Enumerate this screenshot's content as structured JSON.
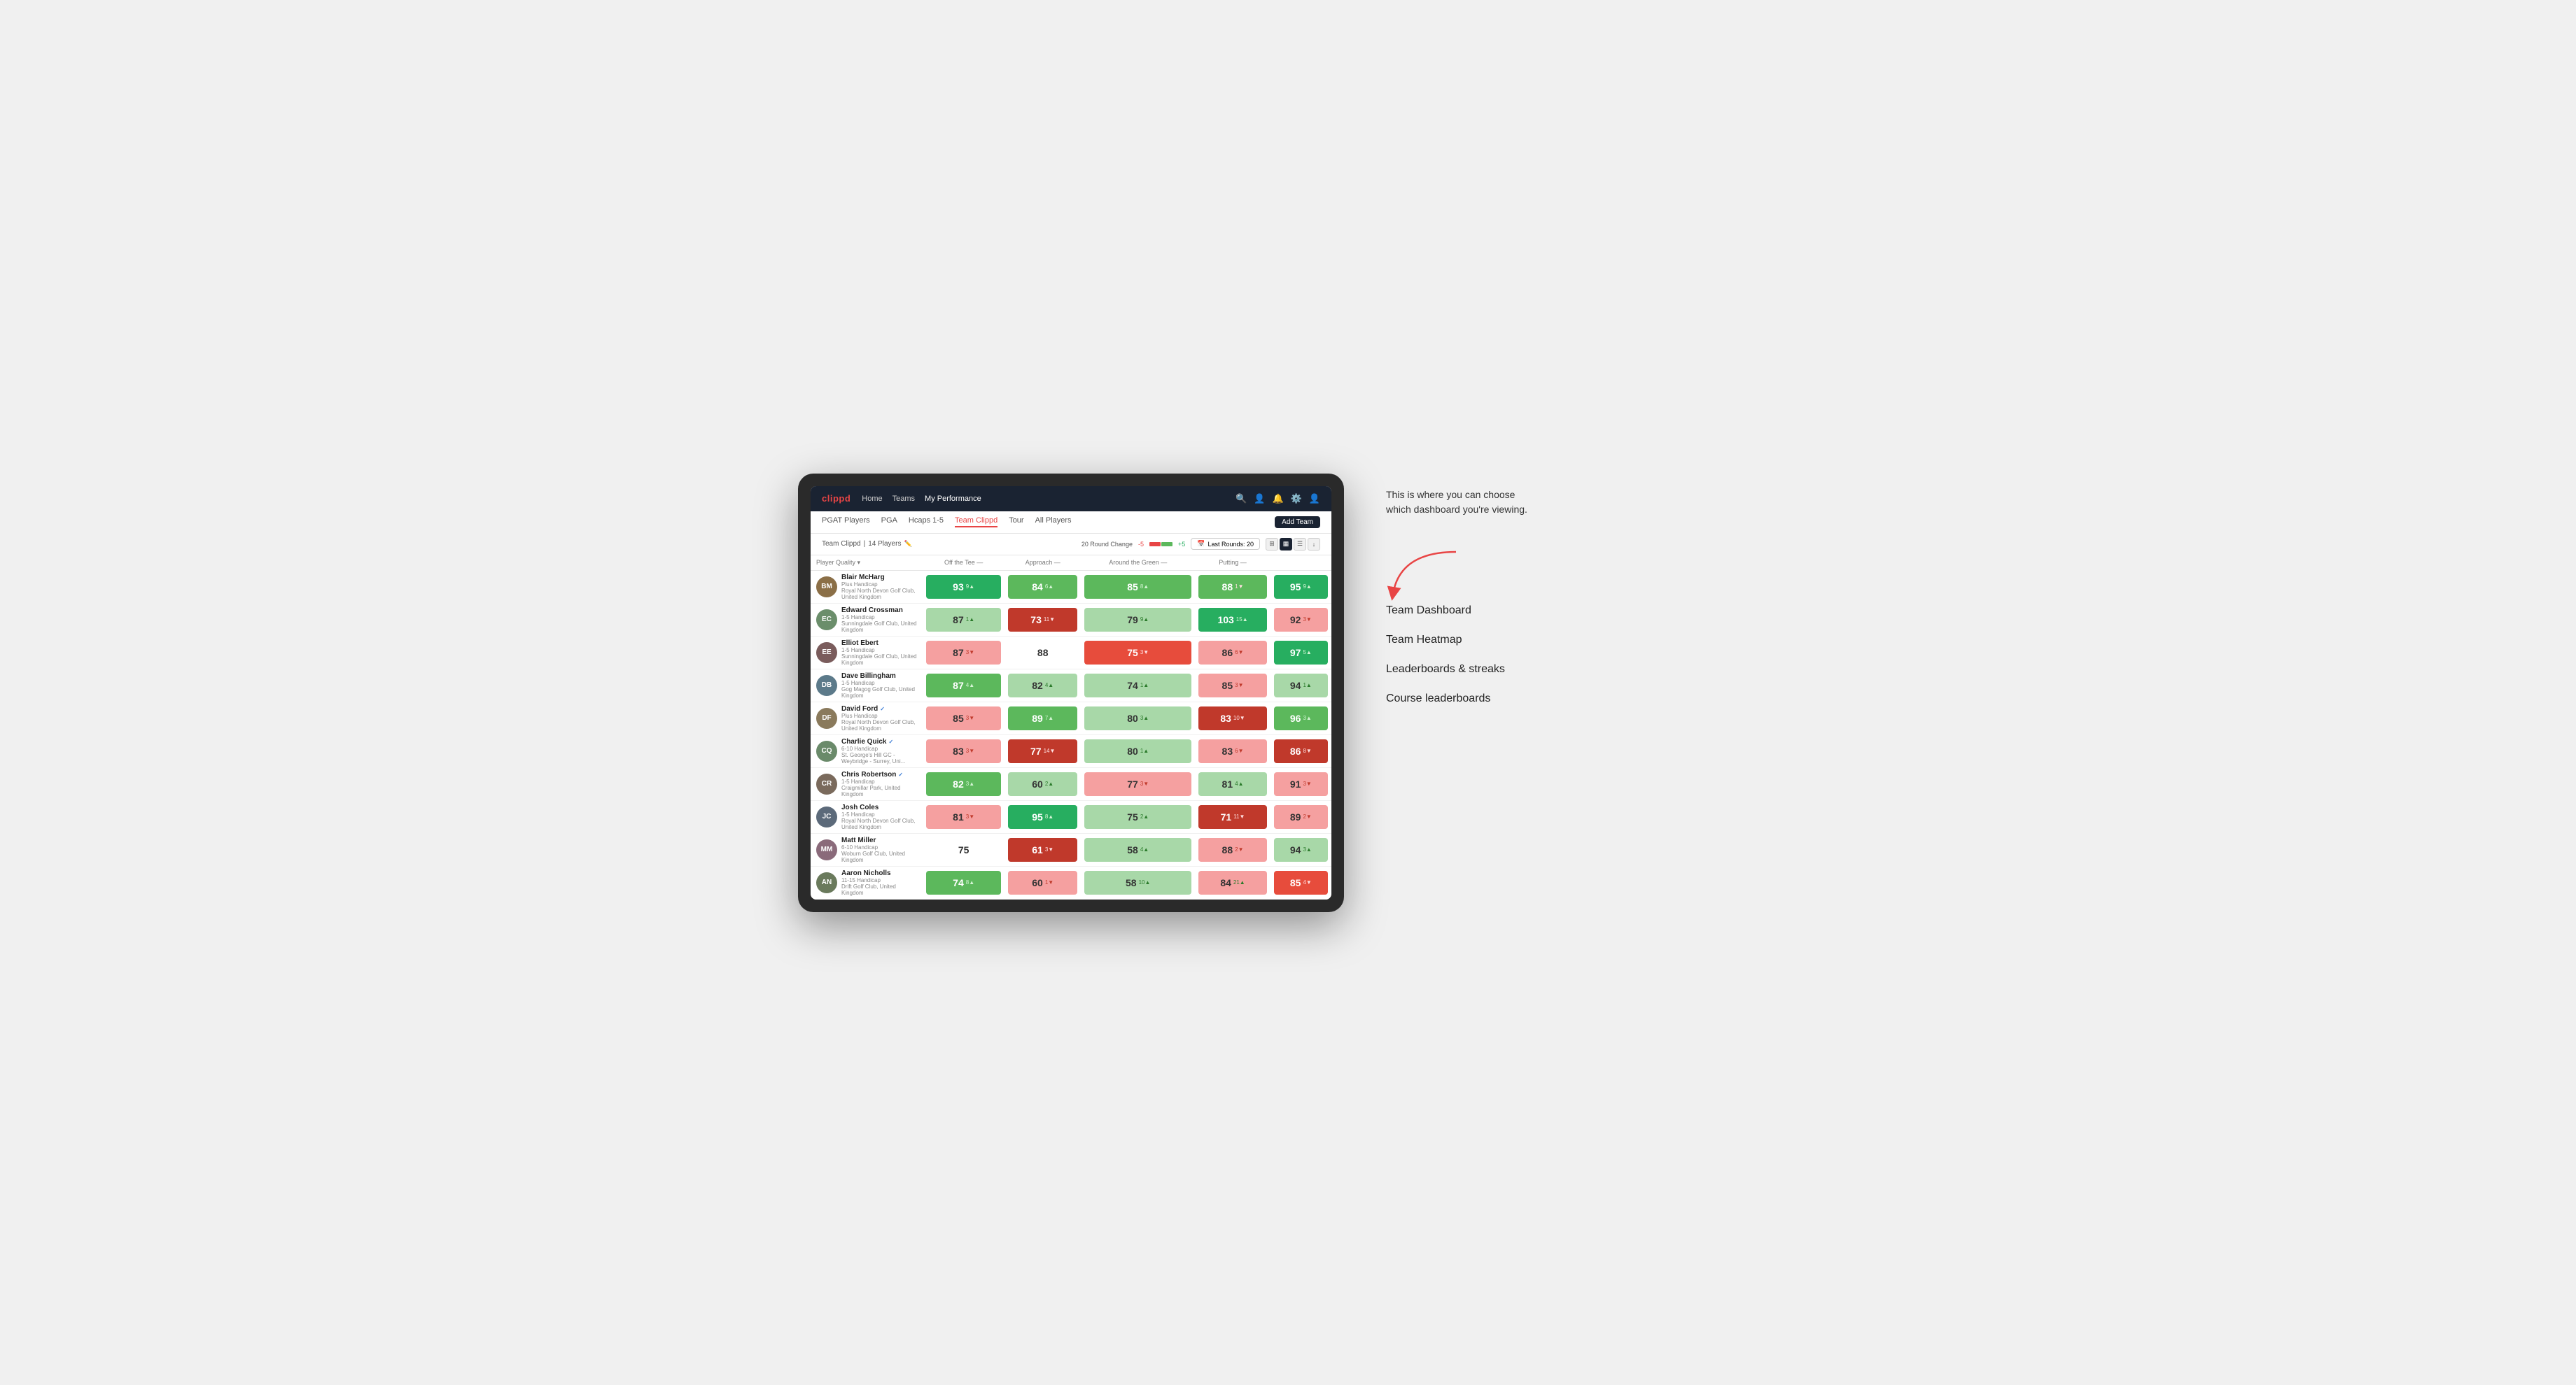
{
  "annotation": {
    "description": "This is where you can choose which dashboard you're viewing.",
    "options": [
      "Team Dashboard",
      "Team Heatmap",
      "Leaderboards & streaks",
      "Course leaderboards"
    ]
  },
  "nav": {
    "logo": "clippd",
    "links": [
      "Home",
      "Teams",
      "My Performance"
    ],
    "active_link": "My Performance"
  },
  "sub_nav": {
    "links": [
      "PGAT Players",
      "PGA",
      "Hcaps 1-5",
      "Team Clippd",
      "Tour",
      "All Players"
    ],
    "active": "Team Clippd",
    "add_team_label": "Add Team"
  },
  "team_header": {
    "team_name": "Team Clippd",
    "player_count": "14 Players",
    "round_change_label": "20 Round Change",
    "change_min": "-5",
    "change_max": "+5",
    "last_rounds_label": "Last Rounds: 20"
  },
  "table": {
    "col_headers": {
      "player": "Player Quality ▾",
      "off_tee": "Off the Tee —",
      "approach": "Approach —",
      "around_green": "Around the Green —",
      "putting": "Putting —"
    },
    "players": [
      {
        "name": "Blair McHarg",
        "handicap": "Plus Handicap",
        "club": "Royal North Devon Golf Club, United Kingdom",
        "initials": "BM",
        "avatar_color": "#8B6F47",
        "off_tee": {
          "val": "93",
          "change": "9▲",
          "dir": "up",
          "bg": "bg-green-strong"
        },
        "approach": {
          "val": "84",
          "change": "6▲",
          "dir": "up",
          "bg": "bg-green-mid"
        },
        "around_green": {
          "val": "85",
          "change": "8▲",
          "dir": "up",
          "bg": "bg-green-mid"
        },
        "atg": {
          "val": "88",
          "change": "1▼",
          "dir": "down",
          "bg": "bg-green-mid"
        },
        "putting": {
          "val": "95",
          "change": "9▲",
          "dir": "up",
          "bg": "bg-green-strong"
        }
      },
      {
        "name": "Edward Crossman",
        "handicap": "1-5 Handicap",
        "club": "Sunningdale Golf Club, United Kingdom",
        "initials": "EC",
        "avatar_color": "#6B8E6B",
        "off_tee": {
          "val": "87",
          "change": "1▲",
          "dir": "up",
          "bg": "bg-green-light"
        },
        "approach": {
          "val": "73",
          "change": "11▼",
          "dir": "down",
          "bg": "bg-red-strong"
        },
        "around_green": {
          "val": "79",
          "change": "9▲",
          "dir": "up",
          "bg": "bg-green-light"
        },
        "atg": {
          "val": "103",
          "change": "15▲",
          "dir": "up",
          "bg": "bg-green-strong"
        },
        "putting": {
          "val": "92",
          "change": "3▼",
          "dir": "down",
          "bg": "bg-red-light"
        }
      },
      {
        "name": "Elliot Ebert",
        "handicap": "1-5 Handicap",
        "club": "Sunningdale Golf Club, United Kingdom",
        "initials": "EE",
        "avatar_color": "#7a5c5c",
        "off_tee": {
          "val": "87",
          "change": "3▼",
          "dir": "down",
          "bg": "bg-red-light"
        },
        "approach": {
          "val": "88",
          "change": "",
          "dir": "none",
          "bg": "bg-none"
        },
        "around_green": {
          "val": "75",
          "change": "3▼",
          "dir": "down",
          "bg": "bg-red-mid"
        },
        "atg": {
          "val": "86",
          "change": "6▼",
          "dir": "down",
          "bg": "bg-red-light"
        },
        "putting": {
          "val": "97",
          "change": "5▲",
          "dir": "up",
          "bg": "bg-green-strong"
        }
      },
      {
        "name": "Dave Billingham",
        "handicap": "1-5 Handicap",
        "club": "Gog Magog Golf Club, United Kingdom",
        "initials": "DB",
        "avatar_color": "#5c7a8a",
        "off_tee": {
          "val": "87",
          "change": "4▲",
          "dir": "up",
          "bg": "bg-green-mid"
        },
        "approach": {
          "val": "82",
          "change": "4▲",
          "dir": "up",
          "bg": "bg-green-light"
        },
        "around_green": {
          "val": "74",
          "change": "1▲",
          "dir": "up",
          "bg": "bg-green-light"
        },
        "atg": {
          "val": "85",
          "change": "3▼",
          "dir": "down",
          "bg": "bg-red-light"
        },
        "putting": {
          "val": "94",
          "change": "1▲",
          "dir": "up",
          "bg": "bg-green-light"
        }
      },
      {
        "name": "David Ford",
        "handicap": "Plus Handicap",
        "club": "Royal North Devon Golf Club, United Kingdom",
        "initials": "DF",
        "avatar_color": "#8a7a5c",
        "verified": true,
        "off_tee": {
          "val": "85",
          "change": "3▼",
          "dir": "down",
          "bg": "bg-red-light"
        },
        "approach": {
          "val": "89",
          "change": "7▲",
          "dir": "up",
          "bg": "bg-green-mid"
        },
        "around_green": {
          "val": "80",
          "change": "3▲",
          "dir": "up",
          "bg": "bg-green-light"
        },
        "atg": {
          "val": "83",
          "change": "10▼",
          "dir": "down",
          "bg": "bg-red-strong"
        },
        "putting": {
          "val": "96",
          "change": "3▲",
          "dir": "up",
          "bg": "bg-green-mid"
        }
      },
      {
        "name": "Charlie Quick",
        "handicap": "6-10 Handicap",
        "club": "St. George's Hill GC - Weybridge - Surrey, Uni...",
        "initials": "CQ",
        "avatar_color": "#6a8a6a",
        "verified": true,
        "off_tee": {
          "val": "83",
          "change": "3▼",
          "dir": "down",
          "bg": "bg-red-light"
        },
        "approach": {
          "val": "77",
          "change": "14▼",
          "dir": "down",
          "bg": "bg-red-strong"
        },
        "around_green": {
          "val": "80",
          "change": "1▲",
          "dir": "up",
          "bg": "bg-green-light"
        },
        "atg": {
          "val": "83",
          "change": "6▼",
          "dir": "down",
          "bg": "bg-red-light"
        },
        "putting": {
          "val": "86",
          "change": "8▼",
          "dir": "down",
          "bg": "bg-red-strong"
        }
      },
      {
        "name": "Chris Robertson",
        "handicap": "1-5 Handicap",
        "club": "Craigmillar Park, United Kingdom",
        "initials": "CR",
        "avatar_color": "#7a6a5c",
        "verified": true,
        "off_tee": {
          "val": "82",
          "change": "3▲",
          "dir": "up",
          "bg": "bg-green-mid"
        },
        "approach": {
          "val": "60",
          "change": "2▲",
          "dir": "up",
          "bg": "bg-green-light"
        },
        "around_green": {
          "val": "77",
          "change": "3▼",
          "dir": "down",
          "bg": "bg-red-light"
        },
        "atg": {
          "val": "81",
          "change": "4▲",
          "dir": "up",
          "bg": "bg-green-light"
        },
        "putting": {
          "val": "91",
          "change": "3▼",
          "dir": "down",
          "bg": "bg-red-light"
        }
      },
      {
        "name": "Josh Coles",
        "handicap": "1-5 Handicap",
        "club": "Royal North Devon Golf Club, United Kingdom",
        "initials": "JC",
        "avatar_color": "#5c6a7a",
        "off_tee": {
          "val": "81",
          "change": "3▼",
          "dir": "down",
          "bg": "bg-red-light"
        },
        "approach": {
          "val": "95",
          "change": "8▲",
          "dir": "up",
          "bg": "bg-green-strong"
        },
        "around_green": {
          "val": "75",
          "change": "2▲",
          "dir": "up",
          "bg": "bg-green-light"
        },
        "atg": {
          "val": "71",
          "change": "11▼",
          "dir": "down",
          "bg": "bg-red-strong"
        },
        "putting": {
          "val": "89",
          "change": "2▼",
          "dir": "down",
          "bg": "bg-red-light"
        }
      },
      {
        "name": "Matt Miller",
        "handicap": "6-10 Handicap",
        "club": "Woburn Golf Club, United Kingdom",
        "initials": "MM",
        "avatar_color": "#8a6a7a",
        "off_tee": {
          "val": "75",
          "change": "",
          "dir": "none",
          "bg": "bg-none"
        },
        "approach": {
          "val": "61",
          "change": "3▼",
          "dir": "down",
          "bg": "bg-red-strong"
        },
        "around_green": {
          "val": "58",
          "change": "4▲",
          "dir": "up",
          "bg": "bg-green-light"
        },
        "atg": {
          "val": "88",
          "change": "2▼",
          "dir": "down",
          "bg": "bg-red-light"
        },
        "putting": {
          "val": "94",
          "change": "3▲",
          "dir": "up",
          "bg": "bg-green-light"
        }
      },
      {
        "name": "Aaron Nicholls",
        "handicap": "11-15 Handicap",
        "club": "Drift Golf Club, United Kingdom",
        "initials": "AN",
        "avatar_color": "#6a7a5c",
        "off_tee": {
          "val": "74",
          "change": "8▲",
          "dir": "up",
          "bg": "bg-green-mid"
        },
        "approach": {
          "val": "60",
          "change": "1▼",
          "dir": "down",
          "bg": "bg-red-light"
        },
        "around_green": {
          "val": "58",
          "change": "10▲",
          "dir": "up",
          "bg": "bg-green-light"
        },
        "atg": {
          "val": "84",
          "change": "21▲",
          "dir": "up",
          "bg": "bg-red-light"
        },
        "putting": {
          "val": "85",
          "change": "4▼",
          "dir": "down",
          "bg": "bg-red-mid"
        }
      }
    ]
  }
}
